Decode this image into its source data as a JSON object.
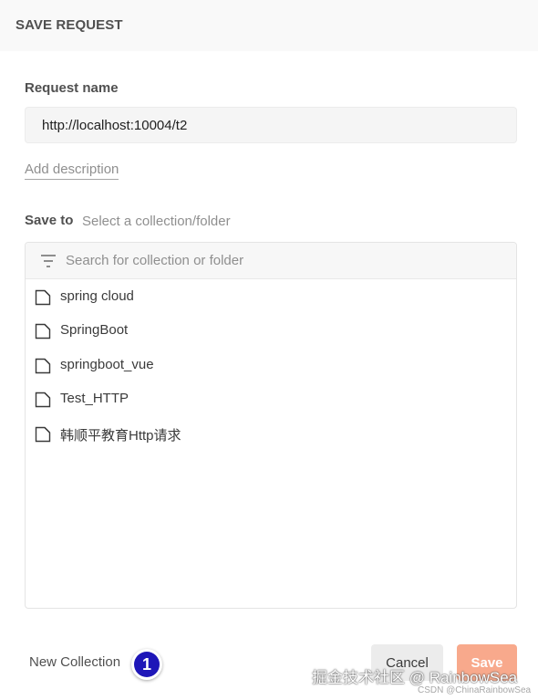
{
  "header": {
    "title": "SAVE REQUEST"
  },
  "request_name": {
    "label": "Request name",
    "value": "http://localhost:10004/t2"
  },
  "add_description": "Add description",
  "save_to": {
    "label": "Save to",
    "hint": "Select a collection/folder"
  },
  "search": {
    "placeholder": "Search for collection or folder",
    "icon": "filter-icon"
  },
  "collections": [
    {
      "label": "spring cloud",
      "icon": "collection-icon"
    },
    {
      "label": "SpringBoot",
      "icon": "collection-icon"
    },
    {
      "label": "springboot_vue",
      "icon": "collection-icon"
    },
    {
      "label": "Test_HTTP",
      "icon": "collection-icon"
    },
    {
      "label": "韩顺平教育Http请求",
      "icon": "collection-icon"
    }
  ],
  "footer": {
    "new_collection": "New Collection",
    "badge": "1",
    "cancel": "Cancel",
    "save": "Save"
  },
  "watermark": {
    "main": "掘金技术社区 @ RainbowSea",
    "sub": "CSDN @ChinaRainbowSea"
  },
  "colors": {
    "accent": "#f8a98c",
    "badge": "#1e16b8",
    "header_bg": "#f9f9f9"
  }
}
